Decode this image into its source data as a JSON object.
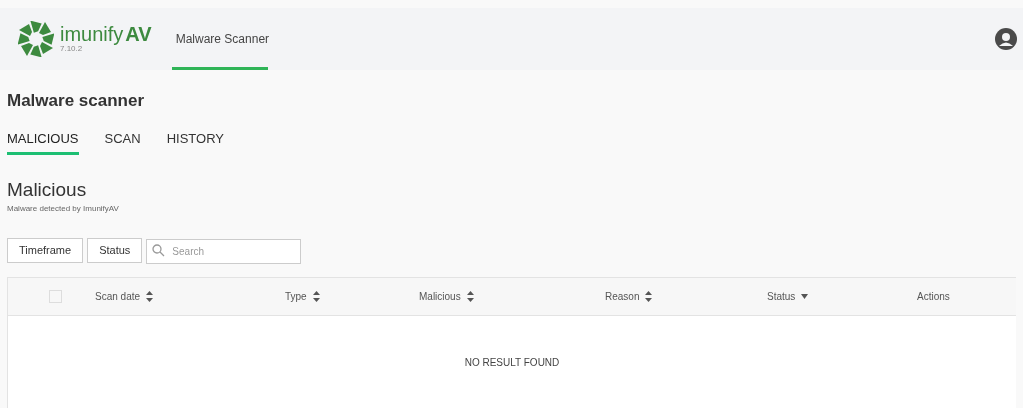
{
  "header": {
    "brand": "imunify",
    "brand_suffix": "AV",
    "version": "7.10.2",
    "nav": [
      {
        "label": "Malware Scanner",
        "selected": true
      }
    ]
  },
  "page_title": "Malware scanner",
  "tabs": [
    {
      "label": "MALICIOUS",
      "selected": true
    },
    {
      "label": "SCAN",
      "selected": false
    },
    {
      "label": "HISTORY",
      "selected": false
    }
  ],
  "section": {
    "title": "Malicious",
    "subtitle": "Malware detected by ImunifyAV"
  },
  "filters": [
    {
      "label": "Timeframe"
    },
    {
      "label": "Status"
    }
  ],
  "search": {
    "placeholder": "Search"
  },
  "table": {
    "select_all": {
      "checked": false
    },
    "columns": [
      {
        "label": "Scan date",
        "kind": "sortable"
      },
      {
        "label": "Type",
        "kind": "sortable"
      },
      {
        "label": "Malicious",
        "kind": "sortable"
      },
      {
        "label": "Reason",
        "kind": "sortable"
      },
      {
        "label": "Status",
        "kind": "sorted"
      },
      {
        "label": "Actions",
        "kind": "plain"
      }
    ],
    "empty_text": "NO RESULT FOUND"
  }
}
